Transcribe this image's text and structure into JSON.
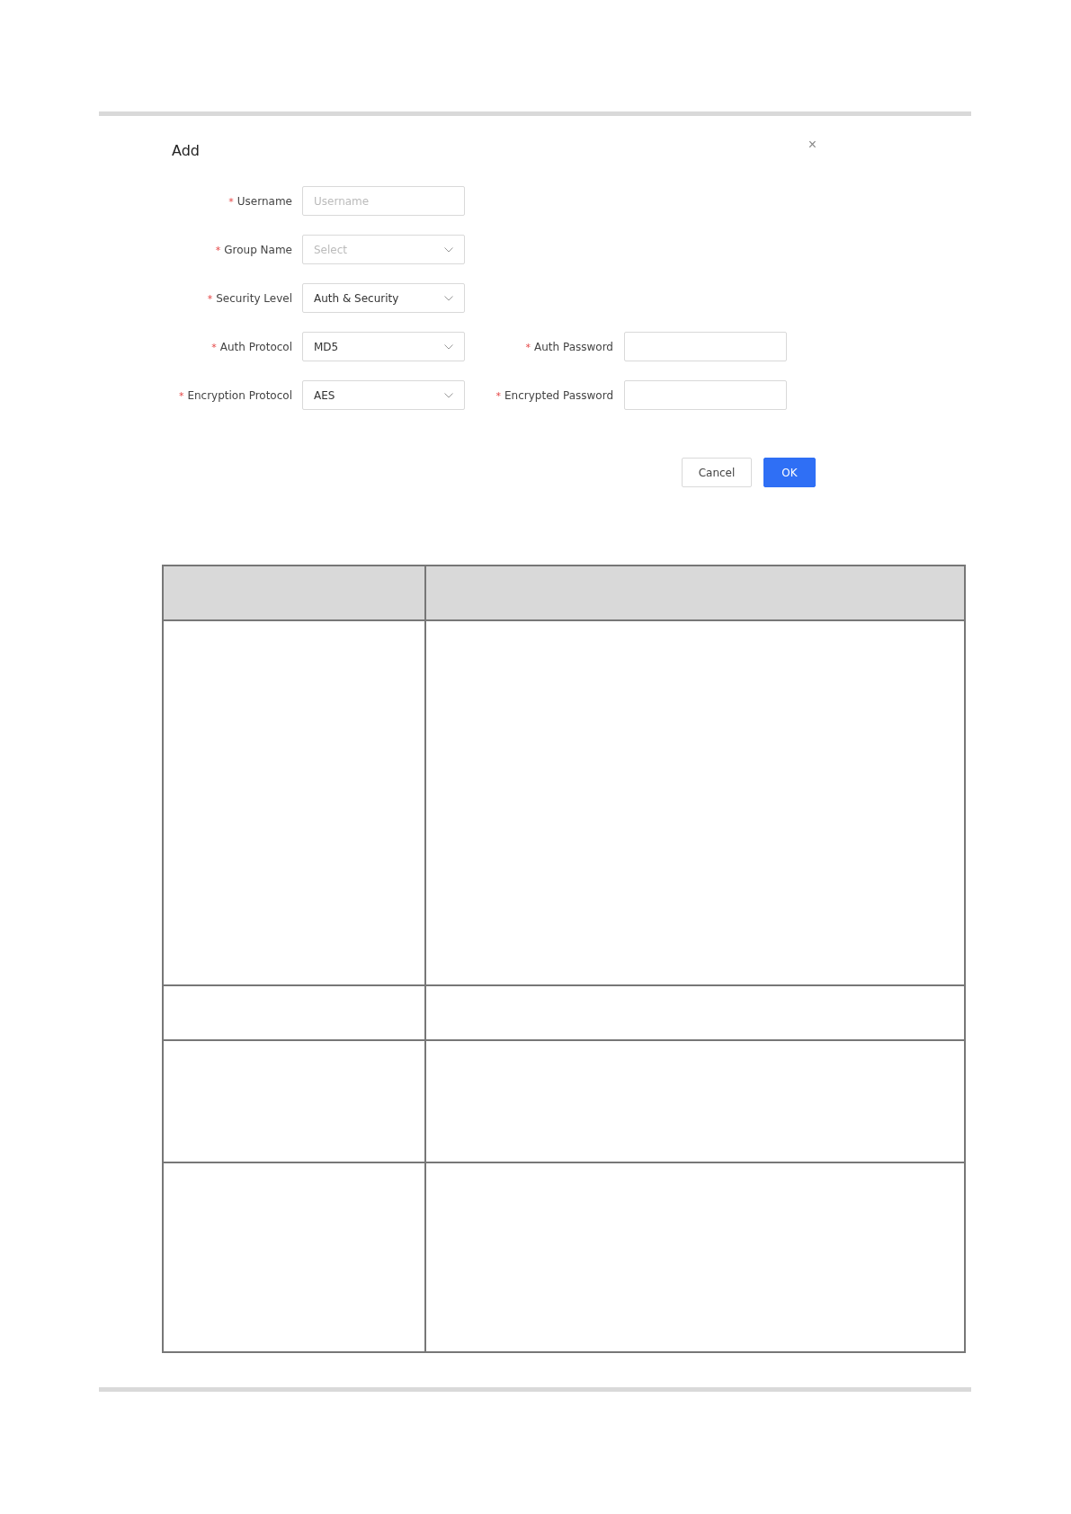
{
  "dialog": {
    "title": "Add",
    "close": "×",
    "rows": [
      {
        "fields": [
          {
            "kind": "input",
            "marker": "*",
            "label": "Username",
            "placeholder": "Username"
          }
        ]
      },
      {
        "fields": [
          {
            "kind": "select",
            "marker": "*",
            "label": "Group Name",
            "placeholder": "Select"
          }
        ]
      },
      {
        "fields": [
          {
            "kind": "select",
            "marker": "*",
            "label": "Security Level",
            "value": "Auth & Security"
          }
        ]
      },
      {
        "fields": [
          {
            "kind": "select",
            "marker": "*",
            "label": "Auth Protocol",
            "value": "MD5"
          },
          {
            "kind": "input",
            "marker": "*",
            "label": "Auth Password"
          }
        ]
      },
      {
        "fields": [
          {
            "kind": "select",
            "marker": "*",
            "label": "Encryption Protocol",
            "value": "AES"
          },
          {
            "kind": "input",
            "marker": "*",
            "label": "Encrypted Password"
          }
        ]
      }
    ],
    "buttons": [
      {
        "kind": "secondary",
        "label": "Cancel"
      },
      {
        "kind": "primary",
        "label": "OK"
      }
    ]
  }
}
